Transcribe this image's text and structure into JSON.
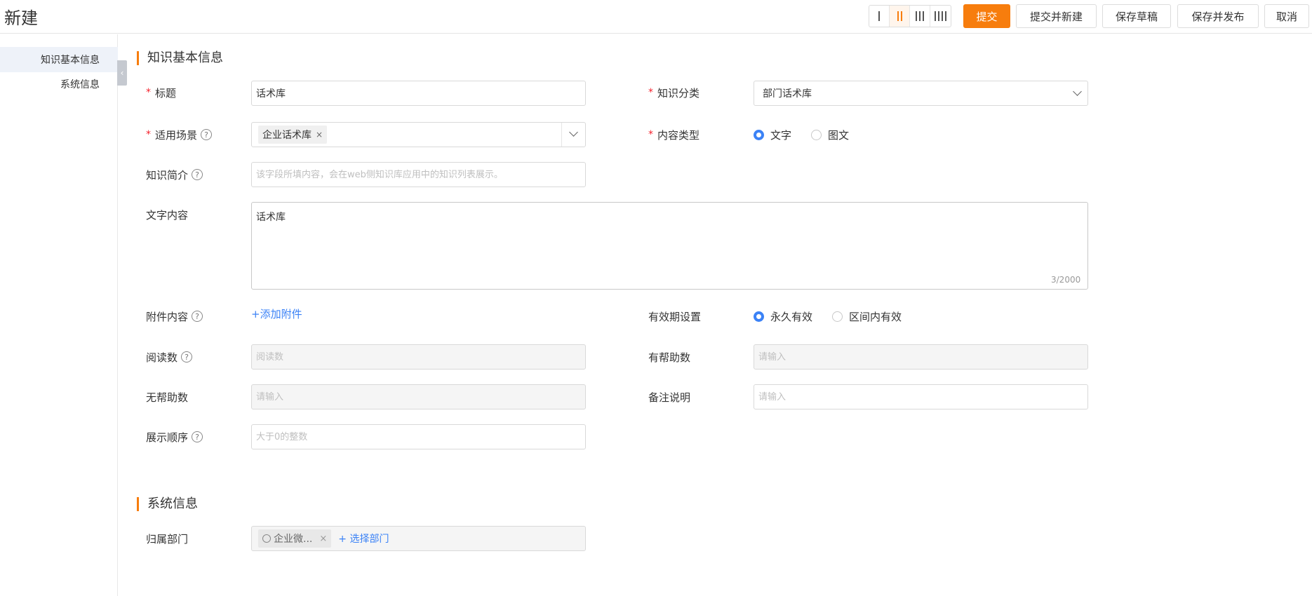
{
  "header": {
    "title": "新建",
    "column_options": [
      "1",
      "2",
      "3",
      "4"
    ],
    "active_columns": 2,
    "buttons": {
      "submit": "提交",
      "submit_new": "提交并新建",
      "save_draft": "保存草稿",
      "save_publish": "保存并发布",
      "cancel": "取消"
    },
    "accent_color": "#f77d0d"
  },
  "leftnav": {
    "items": [
      {
        "label": "知识基本信息",
        "active": true
      },
      {
        "label": "系统信息",
        "active": false
      }
    ],
    "collapse_icon": "chevron-left-icon"
  },
  "section_basic": {
    "title": "知识基本信息",
    "title_field": {
      "label": "标题",
      "value": "话术库"
    },
    "category": {
      "label": "知识分类",
      "value": "部门话术库"
    },
    "scene": {
      "label": "适用场景",
      "tag": "企业话术库"
    },
    "content_type": {
      "label": "内容类型",
      "options": [
        "文字",
        "图文"
      ],
      "selected": "文字"
    },
    "intro": {
      "label": "知识简介",
      "placeholder": "该字段所填内容，会在web侧知识库应用中的知识列表展示。"
    },
    "text_content": {
      "label": "文字内容",
      "value": "话术库",
      "counter": "3/2000"
    },
    "attachment": {
      "label": "附件内容",
      "link": "+添加附件"
    },
    "validity": {
      "label": "有效期设置",
      "options": [
        "永久有效",
        "区间内有效"
      ],
      "selected": "永久有效"
    },
    "reads": {
      "label": "阅读数",
      "placeholder": "阅读数"
    },
    "helpful": {
      "label": "有帮助数",
      "placeholder": "请输入"
    },
    "unhelpful": {
      "label": "无帮助数",
      "placeholder": "请输入"
    },
    "remark": {
      "label": "备注说明",
      "placeholder": "请输入"
    },
    "order": {
      "label": "展示顺序",
      "placeholder": "大于0的整数"
    }
  },
  "section_system": {
    "title": "系统信息",
    "dept": {
      "label": "归属部门",
      "tag": "企业微...",
      "choose": "+ 选择部门"
    }
  }
}
